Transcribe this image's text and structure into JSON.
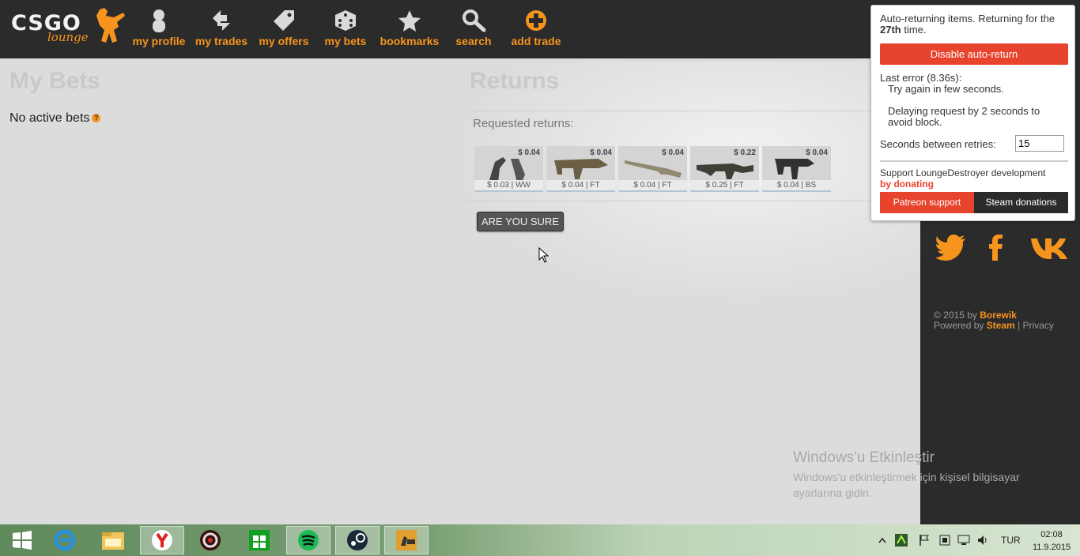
{
  "nav": {
    "logo_text": "CSGO",
    "logo_sub": "lounge",
    "items": [
      {
        "label": "my profile",
        "icon": "profile-icon"
      },
      {
        "label": "my trades",
        "icon": "trades-icon"
      },
      {
        "label": "my offers",
        "icon": "tag-icon"
      },
      {
        "label": "my bets",
        "icon": "dice-icon"
      },
      {
        "label": "bookmarks",
        "icon": "star-icon"
      },
      {
        "label": "search",
        "icon": "search-icon"
      },
      {
        "label": "add trade",
        "icon": "plus-circle-icon"
      }
    ]
  },
  "left": {
    "title": "My Bets",
    "no_bets": "No active bets",
    "help_glyph": "?"
  },
  "returns": {
    "title": "Returns",
    "requested_label": "Requested returns:",
    "items": [
      {
        "price": "$ 0.04",
        "rarity": "$ 0.03 | WW"
      },
      {
        "price": "$ 0.04",
        "rarity": "$ 0.04 | FT"
      },
      {
        "price": "$ 0.04",
        "rarity": "$ 0.04 | FT"
      },
      {
        "price": "$ 0.22",
        "rarity": "$ 0.25 | FT"
      },
      {
        "price": "$ 0.04",
        "rarity": "$ 0.04 | BS"
      }
    ],
    "confirm_button": "ARE YOU SURE"
  },
  "popup": {
    "status_pre": "Auto-returning items. Returning for the ",
    "status_bold": "27th",
    "status_post": " time.",
    "disable_button": "Disable auto-return",
    "last_error": "Last error (8.36s):",
    "error_msg": "Try again in few seconds.",
    "delay_msg": "Delaying request by 2 seconds to avoid block.",
    "retries_label": "Seconds between retries:",
    "retries_value": "15",
    "support_text": "Support LoungeDestroyer development",
    "donating_text": "by donating",
    "patreon_button": "Patreon support",
    "steam_button": "Steam donations"
  },
  "footer": {
    "copy_pre": "© 2015 by ",
    "author": "Borewik",
    "powered_pre": "Powered by ",
    "steam": "Steam",
    "sep": " | ",
    "privacy": "Privacy"
  },
  "watermark": {
    "title": "Windows'u Etkinleştir",
    "text": "Windows'u etkinleştirmek için kişisel bilgisayar ayarlarına gidin."
  },
  "taskbar": {
    "lang": "TUR",
    "time": "02:08",
    "date": "11.9.2015"
  },
  "colors": {
    "accent": "#f7941d",
    "danger": "#e8432d",
    "dark": "#2b2b2b"
  }
}
